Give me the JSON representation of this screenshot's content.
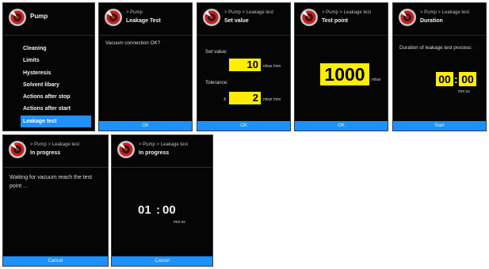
{
  "colors": {
    "accent": "#1e90ff",
    "highlight": "#ffee00",
    "background": "#050505"
  },
  "logo_icon": "pump-logo",
  "screen1": {
    "title": "Pump",
    "menu": [
      "Cleaning",
      "Limits",
      "Hysteresis",
      "Solvent libary",
      "Actions after stop",
      "Actions after start",
      "Leakage test"
    ],
    "selected_index": 6
  },
  "screen2": {
    "breadcrumb": "> Pump",
    "title": "Leakage Test",
    "message": "Vacuum connection OK?",
    "button": "OK"
  },
  "screen3": {
    "breadcrumb": "> Pump > Leakage test",
    "title": "Set value",
    "set_value_label": "Set value:",
    "set_value": "10",
    "set_value_unit": "mbar /min",
    "tolerance_label": "Tolerance:",
    "tolerance_prefix": "±",
    "tolerance": "2",
    "tolerance_unit": "mbar /min",
    "button": "OK"
  },
  "screen4": {
    "breadcrumb": "> Pump > Leakage test",
    "title": "Test point",
    "value": "1000",
    "unit": "mbar",
    "button": "OK"
  },
  "screen5": {
    "breadcrumb": "> Pump > Leakage test",
    "title": "Duration",
    "description": "Duration of leakage test process:",
    "hours": "00",
    "minutes": "00",
    "unit": "mm:ss",
    "button": "Start"
  },
  "screen6": {
    "breadcrumb": "> Pump > Leakage test",
    "title": "In progress",
    "message": "Waiting for vacuum reach the test point ...",
    "button": "Cancel"
  },
  "screen7": {
    "breadcrumb": "> Pump > Leakage test",
    "title": "In progress",
    "minutes": "01",
    "seconds": "00",
    "unit": "mm:ss",
    "button": "Cancel"
  }
}
